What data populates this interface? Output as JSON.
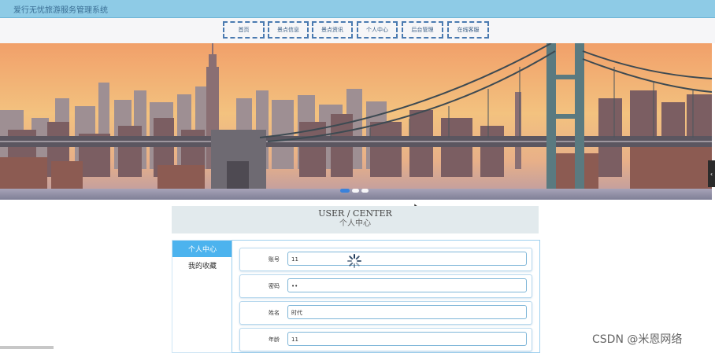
{
  "header": {
    "title": "爱行无忧旅游服务管理系统"
  },
  "nav": {
    "items": [
      "首页",
      "景点信息",
      "景点资讯",
      "个人中心",
      "后台管理",
      "在线客服"
    ]
  },
  "banner": {
    "slide_count": 3,
    "active_slide": 1,
    "next_arrow_icon": "chevron-right-icon"
  },
  "center": {
    "title_en": "USER / CENTER",
    "title_zh": "个人中心"
  },
  "sidebar": {
    "items": [
      "个人中心",
      "我的收藏"
    ],
    "active": "个人中心"
  },
  "form": {
    "rows": [
      {
        "label": "账号",
        "value": "11"
      },
      {
        "label": "密码",
        "value": "••"
      },
      {
        "label": "姓名",
        "value": "时代"
      },
      {
        "label": "年龄",
        "value": "11"
      }
    ]
  },
  "watermark": "CSDN @米恩网络",
  "colors": {
    "header_bg": "#8ecbe6",
    "accent": "#4cb3ee",
    "nav_border": "#4a7ab0"
  }
}
